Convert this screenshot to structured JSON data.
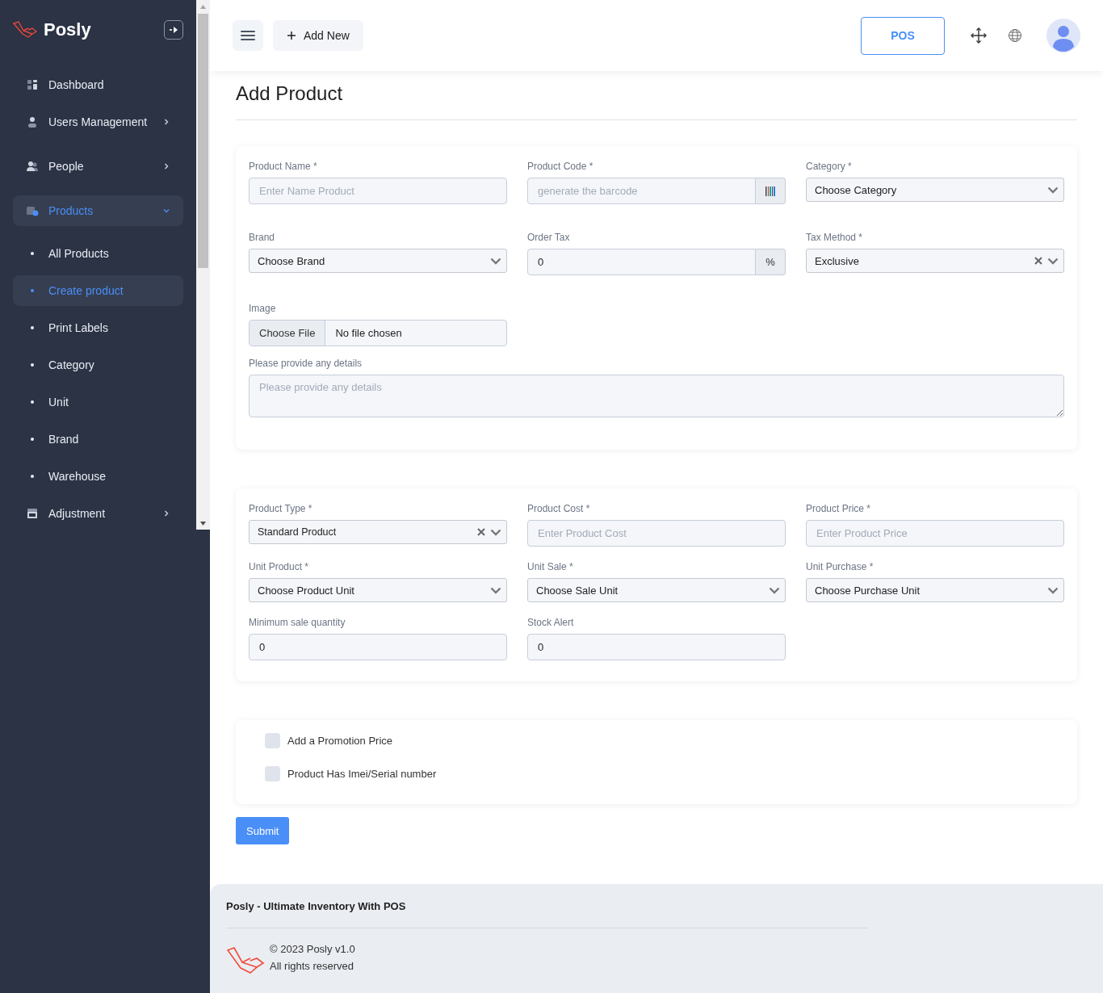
{
  "sidebar": {
    "brand": "Posly",
    "items": [
      {
        "label": "Dashboard",
        "selected": false
      },
      {
        "label": "Users Management",
        "selected": false,
        "expanded": false
      },
      {
        "label": "People",
        "selected": false,
        "expanded": false
      },
      {
        "label": "Products",
        "selected": true,
        "expanded": true,
        "children": [
          {
            "label": "All Products",
            "selected": false
          },
          {
            "label": "Create product",
            "selected": true
          },
          {
            "label": "Print Labels",
            "selected": false
          },
          {
            "label": "Category",
            "selected": false
          },
          {
            "label": "Unit",
            "selected": false
          },
          {
            "label": "Brand",
            "selected": false
          },
          {
            "label": "Warehouse",
            "selected": false
          }
        ]
      },
      {
        "label": "Adjustment",
        "selected": false,
        "expanded": false
      }
    ]
  },
  "header": {
    "add_new": "Add New",
    "pos": "POS"
  },
  "page_title": "Add Product",
  "cards": [
    {
      "kind": "fields",
      "fields": [
        {
          "kind": "text",
          "label": "Product Name *",
          "placeholder": "Enter Name Product"
        },
        {
          "kind": "barcode",
          "label": "Product Code *",
          "placeholder": "generate the barcode"
        },
        {
          "kind": "select",
          "label": "Category *",
          "value": "Choose Category",
          "clearable": false
        },
        {
          "kind": "select",
          "label": "Brand",
          "value": "Choose Brand",
          "clearable": false
        },
        {
          "kind": "addon",
          "label": "Order Tax",
          "value": "0",
          "addon": "%"
        },
        {
          "kind": "select",
          "label": "Tax Method *",
          "value": "Exclusive",
          "clearable": true
        },
        {
          "kind": "file",
          "label": "Image",
          "button": "Choose File",
          "value": "No file chosen"
        },
        {
          "kind": "textarea",
          "label": "Please provide any details",
          "placeholder": "Please provide any details"
        }
      ]
    },
    {
      "kind": "fields",
      "fields": [
        {
          "kind": "select",
          "label": "Product Type *",
          "value": "Standard Product",
          "clearable": true
        },
        {
          "kind": "text",
          "label": "Product Cost *",
          "placeholder": "Enter Product Cost"
        },
        {
          "kind": "text",
          "label": "Product Price *",
          "placeholder": "Enter Product Price"
        },
        {
          "kind": "select",
          "label": "Unit Product *",
          "value": "Choose Product Unit",
          "clearable": false
        },
        {
          "kind": "select",
          "label": "Unit Sale *",
          "value": "Choose Sale Unit",
          "clearable": false
        },
        {
          "kind": "select",
          "label": "Unit Purchase *",
          "value": "Choose Purchase Unit",
          "clearable": false
        },
        {
          "kind": "value",
          "label": "Minimum sale quantity",
          "value": "0"
        },
        {
          "kind": "value",
          "label": "Stock Alert",
          "value": "0"
        }
      ]
    },
    {
      "kind": "checks",
      "checks": [
        {
          "label": "Add a Promotion Price",
          "checked": false
        },
        {
          "label": "Product Has Imei/Serial number",
          "checked": false
        }
      ]
    }
  ],
  "submit": "Submit",
  "footer": {
    "title": "Posly - Ultimate Inventory With POS",
    "copyright": "© 2023 Posly v1.0",
    "rights": "All rights reserved"
  }
}
